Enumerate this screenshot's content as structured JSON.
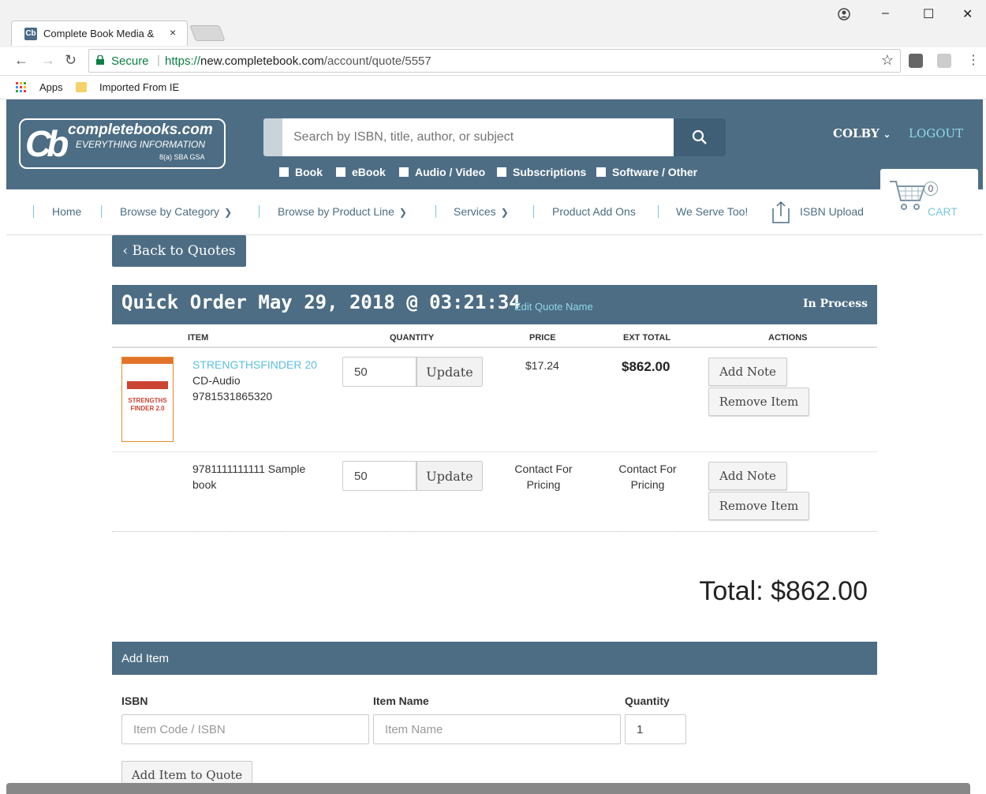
{
  "browser": {
    "tab_title": "Complete Book Media &",
    "tab_close": "×",
    "favicon_text": "Cb",
    "secure_label": "Secure",
    "url_scheme": "https://",
    "url_host": "new.completebook.com",
    "url_path": "/account/quote/5557",
    "bookmarks": {
      "apps": "Apps",
      "imported": "Imported From IE"
    },
    "window_controls": {
      "minimize": "–",
      "maximize": "☐",
      "close": "✕"
    }
  },
  "header": {
    "logo_mono": "Cb",
    "brand": "completebooks.com",
    "tagline": "EVERYTHING INFORMATION",
    "sub": "8(a) SBA GSA",
    "search_placeholder": "Search by ISBN, title, author, or subject",
    "filters": [
      "Book",
      "eBook",
      "Audio / Video",
      "Subscriptions",
      "Software / Other"
    ],
    "user": "COLBY",
    "logout": "LOGOUT",
    "cart_count": "0",
    "cart_label": "CART"
  },
  "nav": {
    "items": [
      "Home",
      "Browse by Category",
      "Browse by Product Line",
      "Services",
      "Product Add Ons",
      "We Serve Too!",
      "ISBN Upload"
    ]
  },
  "quote": {
    "back_label": "‹ Back to Quotes",
    "title": "Quick Order May 29, 2018 @ 03:21:34",
    "edit_name": "Edit Quote Name",
    "status": "In Process",
    "columns": [
      "ITEM",
      "QUANTITY",
      "PRICE",
      "EXT TOTAL",
      "ACTIONS"
    ],
    "rows": [
      {
        "title": "STRENGTHSFINDER 20",
        "format": "CD-Audio",
        "isbn": "9781531865320",
        "qty": "50",
        "update": "Update",
        "price": "$17.24",
        "ext_total": "$862.00",
        "add_note": "Add Note",
        "remove": "Remove Item",
        "thumb_text": "STRENGTHS FINDER 2.0"
      },
      {
        "title": "9781111111111 Sample book",
        "qty": "50",
        "update": "Update",
        "price": "Contact For Pricing",
        "ext_total": "Contact For Pricing",
        "add_note": "Add Note",
        "remove": "Remove Item"
      }
    ],
    "total": "Total: $862.00"
  },
  "add_item": {
    "header": "Add Item",
    "isbn_label": "ISBN",
    "isbn_placeholder": "Item Code / ISBN",
    "name_label": "Item Name",
    "name_placeholder": "Item Name",
    "qty_label": "Quantity",
    "qty_value": "1",
    "button": "Add Item to Quote"
  },
  "colors": {
    "brand_slate": "#4d6d84",
    "link_cyan": "#5bc0de",
    "secure_green": "#0b8043"
  }
}
